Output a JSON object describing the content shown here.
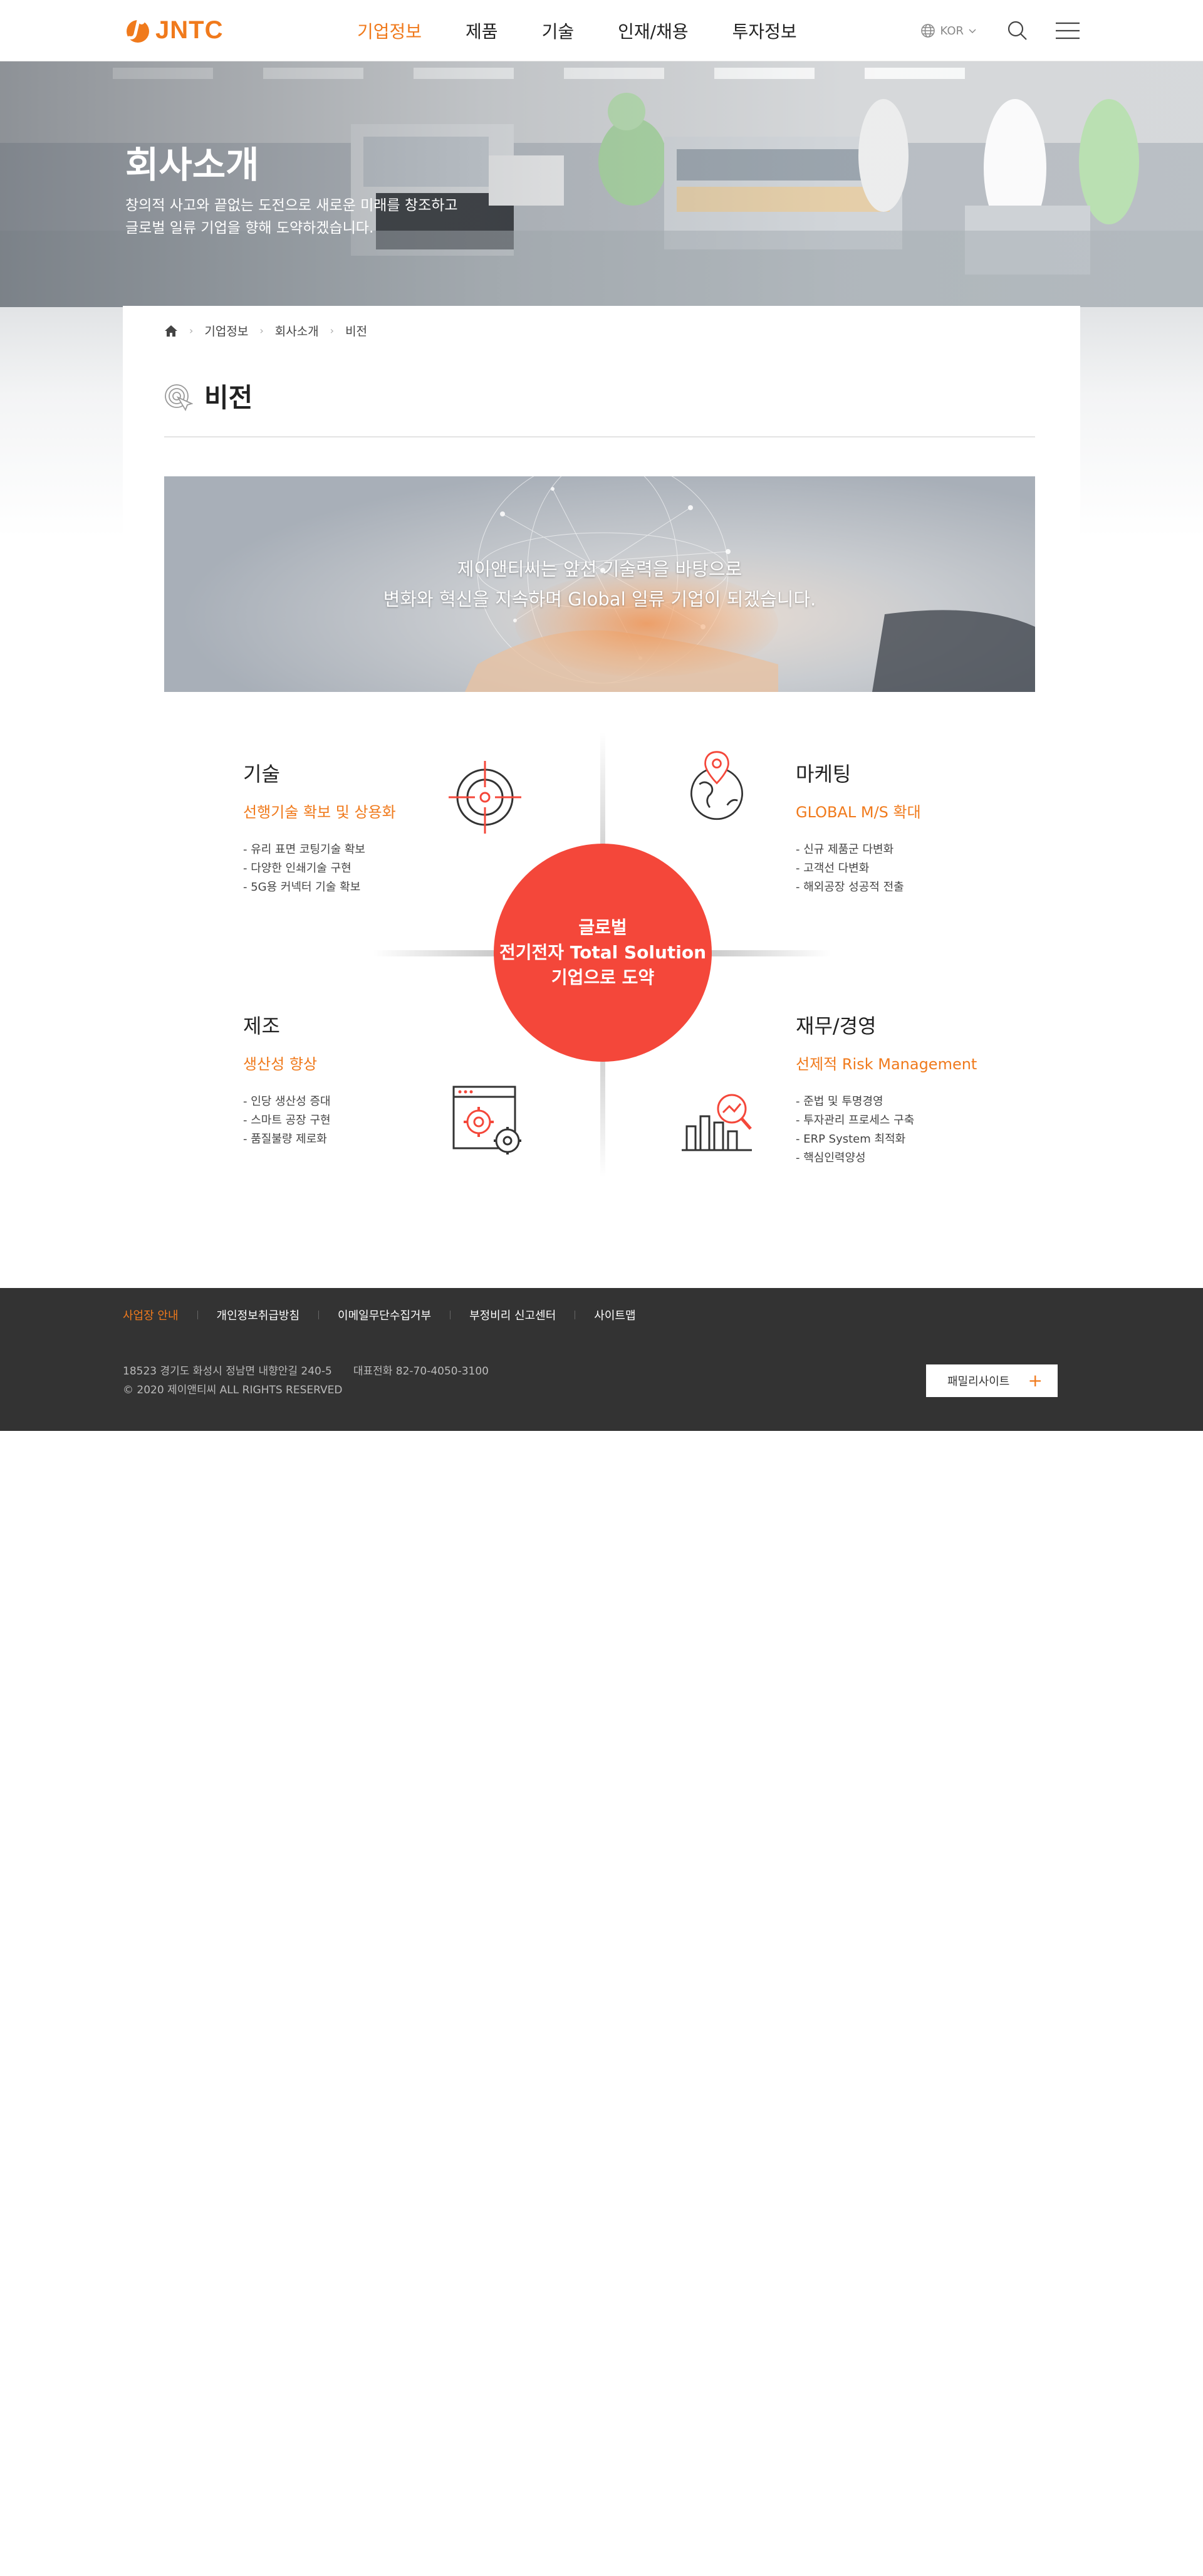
{
  "header": {
    "logo_text": "JNTC",
    "nav": [
      {
        "label": "기업정보",
        "active": true
      },
      {
        "label": "제품",
        "active": false
      },
      {
        "label": "기술",
        "active": false
      },
      {
        "label": "인재/채용",
        "active": false
      },
      {
        "label": "투자정보",
        "active": false
      }
    ],
    "lang_label": "KOR",
    "icons": [
      "globe-icon",
      "search-icon",
      "menu-icon"
    ]
  },
  "hero": {
    "title": "회사소개",
    "desc_line1": "창의적 사고와 끝없는 도전으로 새로운 미래를 창조하고",
    "desc_line2": "글로벌 일류 기업을 향해 도약하겠습니다."
  },
  "breadcrumb": {
    "items": [
      "기업정보",
      "회사소개",
      "비전"
    ]
  },
  "page": {
    "title": "비전"
  },
  "banner": {
    "line1": "제이앤티씨는 앞선 기술력을 바탕으로",
    "line2": "변화와 혁신을 지속하며 Global 일류 기업이 되겠습니다."
  },
  "vision": {
    "center": {
      "line1": "글로벌",
      "line2": "전기전자 Total Solution",
      "line3": "기업으로 도약"
    },
    "quadrants": {
      "tech": {
        "title": "기술",
        "subtitle": "선행기술 확보 및 상용화",
        "items": [
          "- 유리 표면 코팅기술 확보",
          "- 다양한 인쇄기술 구현",
          "- 5G용 커넥터 기술  확보"
        ]
      },
      "marketing": {
        "title": "마케팅",
        "subtitle": "GLOBAL M/S 확대",
        "items": [
          "- 신규 제품군 다변화",
          "- 고객선 다변화",
          "- 해외공장 성공적 전출"
        ]
      },
      "manufacturing": {
        "title": "제조",
        "subtitle": "생산성 향상",
        "items": [
          "- 인당 생산성 증대",
          "- 스마트  공장 구현",
          "- 품질불량 제로화"
        ]
      },
      "finance": {
        "title": "재무/경영",
        "subtitle": "선제적 Risk Management",
        "items": [
          "- 준법 및 투명경영",
          "- 투자관리 프로세스 구축",
          "- ERP System 최적화",
          "- 핵심인력양성"
        ]
      }
    }
  },
  "footer": {
    "links": [
      "사업장 안내",
      "개인정보취급방침",
      "이메일무단수집거부",
      "부정비리 신고센터",
      "사이트맵"
    ],
    "address": "18523 경기도 화성시 정남면 내향안길 240-5",
    "phone": "대표전화 82-70-4050-3100",
    "copyright": "© 2020 제이앤티씨 ALL RIGHTS RESERVED",
    "family_site": "패밀리사이트"
  },
  "colors": {
    "accent": "#f07a1c",
    "center_circle": "#f4473a",
    "footer_bg": "#333333"
  }
}
